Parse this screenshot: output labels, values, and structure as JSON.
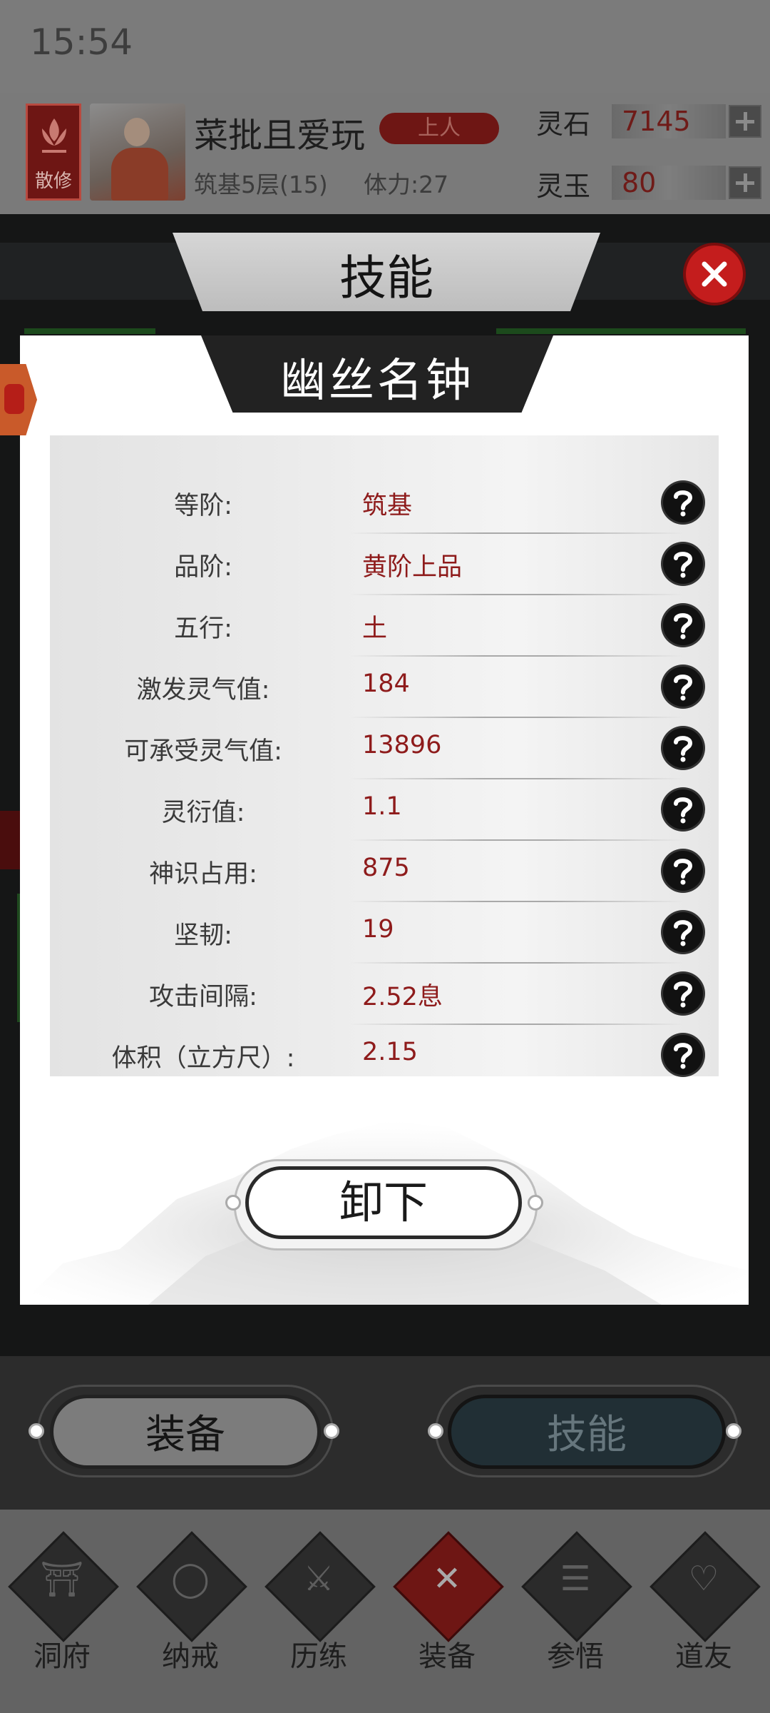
{
  "status": {
    "time": "15:54"
  },
  "player": {
    "sect_label": "散修",
    "name": "菜批且爱玩",
    "rank": "上人",
    "level": "筑基5层(15)",
    "stamina": "体力:27",
    "resources": [
      {
        "label": "灵石",
        "value": "7145"
      },
      {
        "label": "灵玉",
        "value": "80"
      }
    ]
  },
  "skills_panel": {
    "title": "技能"
  },
  "modal": {
    "title": "幽丝名钟",
    "stats": [
      {
        "label": "等阶:",
        "value": "筑基"
      },
      {
        "label": "品阶:",
        "value": "黄阶上品"
      },
      {
        "label": "五行:",
        "value": "土"
      },
      {
        "label": "激发灵气值:",
        "value": "184"
      },
      {
        "label": "可承受灵气值:",
        "value": "13896"
      },
      {
        "label": "灵衍值:",
        "value": "1.1"
      },
      {
        "label": "神识占用:",
        "value": "875"
      },
      {
        "label": "坚韧:",
        "value": "19"
      },
      {
        "label": "攻击间隔:",
        "value": "2.52息"
      },
      {
        "label": "体积（立方尺）:",
        "value": "2.15"
      }
    ],
    "unload_label": "卸下"
  },
  "tabs": {
    "equip_label": "装备",
    "skill_label": "技能"
  },
  "nav": [
    {
      "label": "洞府",
      "icon": "cave-gate-icon",
      "active": false
    },
    {
      "label": "纳戒",
      "icon": "ring-icon",
      "active": false
    },
    {
      "label": "历练",
      "icon": "crossed-swords-icon",
      "active": false
    },
    {
      "label": "装备",
      "icon": "equipment-x-icon",
      "active": true
    },
    {
      "label": "参悟",
      "icon": "open-book-icon",
      "active": false
    },
    {
      "label": "道友",
      "icon": "handshake-icon",
      "active": false
    }
  ],
  "colors": {
    "accent_red": "#c41d1d",
    "value_red": "#8e1b1b",
    "sect_red": "#6e1614"
  }
}
